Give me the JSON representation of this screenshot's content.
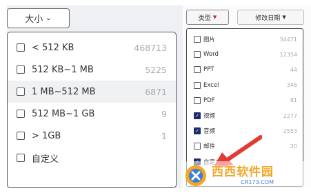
{
  "left_panel": {
    "size_button_label": "大小",
    "items": [
      {
        "label": "< 512 KB",
        "count": "468713",
        "checked": false,
        "highlighted": false
      },
      {
        "label": "512 KB~1 MB",
        "count": "5225",
        "checked": false,
        "highlighted": false
      },
      {
        "label": "1 MB~512 MB",
        "count": "6871",
        "checked": false,
        "highlighted": true
      },
      {
        "label": "512 MB~1 GB",
        "count": "9",
        "checked": false,
        "highlighted": false
      },
      {
        "label": ">  1GB",
        "count": "1",
        "checked": false,
        "highlighted": false
      },
      {
        "label": "自定义",
        "count": "",
        "checked": false,
        "highlighted": false
      }
    ]
  },
  "right_panel": {
    "type_button_label": "类型",
    "date_button_label": "修改日期",
    "items": [
      {
        "label": "图片",
        "count": "34471",
        "checked": false
      },
      {
        "label": "Word",
        "count": "12354",
        "checked": false
      },
      {
        "label": "PPT",
        "count": "44",
        "checked": false
      },
      {
        "label": "Excel",
        "count": "346",
        "checked": false
      },
      {
        "label": "PDF",
        "count": "81",
        "checked": false
      },
      {
        "label": "视频",
        "count": "2277",
        "checked": true
      },
      {
        "label": "音频",
        "count": "2553",
        "checked": true
      },
      {
        "label": "邮件",
        "count": "20",
        "checked": false
      },
      {
        "label": "自定义",
        "count": "",
        "checked": true
      }
    ]
  },
  "watermark": {
    "title": "西西软件园",
    "subtitle": "CR173.COM"
  },
  "colors": {
    "accent_dark_blue": "#1e2b6b",
    "arrow_red": "#e53935",
    "watermark_orange": "#f5a623",
    "watermark_blue": "#3b7dd8"
  }
}
